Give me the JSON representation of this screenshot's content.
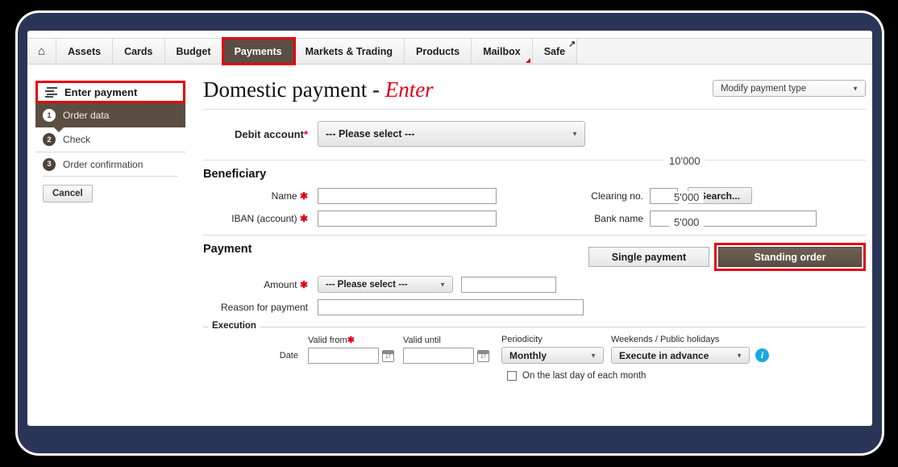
{
  "topnav": {
    "home_icon": "home-icon",
    "tabs": [
      {
        "label": "Assets",
        "active": false
      },
      {
        "label": "Cards",
        "active": false
      },
      {
        "label": "Budget",
        "active": false
      },
      {
        "label": "Payments",
        "active": true
      },
      {
        "label": "Markets & Trading",
        "active": false
      },
      {
        "label": "Products",
        "active": false
      },
      {
        "label": "Mailbox",
        "active": false
      },
      {
        "label": "Safe",
        "active": false
      }
    ]
  },
  "sidebar": {
    "enter_payment": "Enter payment",
    "steps": [
      {
        "num": "1",
        "label": "Order data"
      },
      {
        "num": "2",
        "label": "Check"
      },
      {
        "num": "3",
        "label": "Order confirmation"
      }
    ],
    "cancel": "Cancel"
  },
  "header": {
    "title_main": "Domestic payment - ",
    "title_accent": "Enter",
    "payment_type_select": "Modify payment type"
  },
  "debit": {
    "label": "Debit account",
    "required": "*",
    "value": "--- Please select ---"
  },
  "beneficiary": {
    "section_title": "Beneficiary",
    "name_label": "Name",
    "name_value": "",
    "iban_label": "IBAN (account)",
    "iban_value": "",
    "clearing_label": "Clearing no.",
    "clearing_value": "",
    "search_button": "Search...",
    "bank_label": "Bank name",
    "bank_value": "",
    "overlay_numbers": [
      "10'000",
      "5'000",
      "5'000"
    ]
  },
  "payment": {
    "section_title": "Payment",
    "single_payment": "Single payment",
    "standing_order": "Standing order",
    "amount_label": "Amount",
    "currency_value": "--- Please select ---",
    "amount_value": "",
    "reason_label": "Reason for payment",
    "reason_value": ""
  },
  "execution": {
    "legend": "Execution",
    "date_label": "Date",
    "valid_from_label": "Valid from",
    "valid_from_value": "",
    "valid_until_label": "Valid until",
    "valid_until_value": "",
    "periodicity_label": "Periodicity",
    "periodicity_value": "Monthly",
    "weekends_label": "Weekends / Public holidays",
    "weekends_value": "Execute in advance",
    "info_icon": "info-icon",
    "last_day_label": "On the last day of each month",
    "last_day_checked": false
  },
  "colors": {
    "accent_red": "#e4000f",
    "brand_brown": "#5a4e42",
    "title_red": "#e2001a",
    "info_blue": "#19a8e0",
    "frame_navy": "#2b3557"
  }
}
